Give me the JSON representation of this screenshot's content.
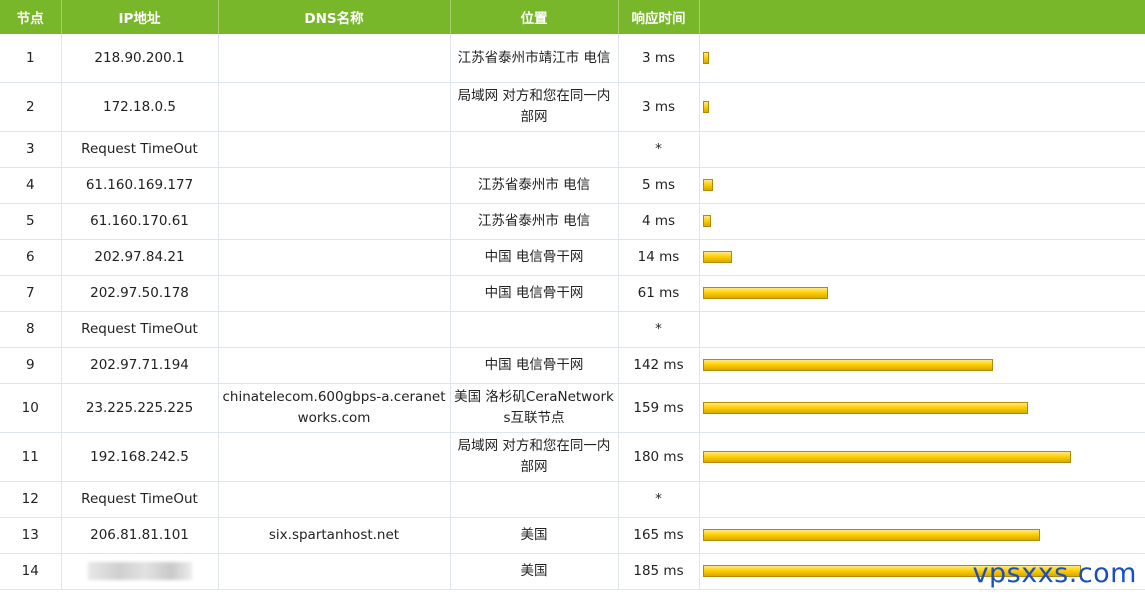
{
  "headers": {
    "hop": "节点",
    "ip": "IP地址",
    "dns": "DNS名称",
    "location": "位置",
    "time": "响应时间",
    "graph": ""
  },
  "bar_scale_ms": 185,
  "bar_color": "#ffd000",
  "header_color": "#78b62a",
  "rows": [
    {
      "hop": "1",
      "ip": "218.90.200.1",
      "dns": "",
      "location": "江苏省泰州市靖江市 电信",
      "time": "3 ms",
      "ms": 3,
      "tall": true
    },
    {
      "hop": "2",
      "ip": "172.18.0.5",
      "dns": "",
      "location": "局域网 对方和您在同一内部网",
      "time": "3 ms",
      "ms": 3,
      "tall": true
    },
    {
      "hop": "3",
      "ip": "Request TimeOut",
      "dns": "",
      "location": "",
      "time": "*",
      "ms": null,
      "tall": false
    },
    {
      "hop": "4",
      "ip": "61.160.169.177",
      "dns": "",
      "location": "江苏省泰州市 电信",
      "time": "5 ms",
      "ms": 5,
      "tall": false
    },
    {
      "hop": "5",
      "ip": "61.160.170.61",
      "dns": "",
      "location": "江苏省泰州市 电信",
      "time": "4 ms",
      "ms": 4,
      "tall": false
    },
    {
      "hop": "6",
      "ip": "202.97.84.21",
      "dns": "",
      "location": "中国 电信骨干网",
      "time": "14 ms",
      "ms": 14,
      "tall": false
    },
    {
      "hop": "7",
      "ip": "202.97.50.178",
      "dns": "",
      "location": "中国 电信骨干网",
      "time": "61 ms",
      "ms": 61,
      "tall": false
    },
    {
      "hop": "8",
      "ip": "Request TimeOut",
      "dns": "",
      "location": "",
      "time": "*",
      "ms": null,
      "tall": false
    },
    {
      "hop": "9",
      "ip": "202.97.71.194",
      "dns": "",
      "location": "中国 电信骨干网",
      "time": "142 ms",
      "ms": 142,
      "tall": false
    },
    {
      "hop": "10",
      "ip": "23.225.225.225",
      "dns": "chinatelecom.600gbps-a.ceranetworks.com",
      "location": "美国 洛杉矶CeraNetworks互联节点",
      "time": "159 ms",
      "ms": 159,
      "tall": true
    },
    {
      "hop": "11",
      "ip": "192.168.242.5",
      "dns": "",
      "location": "局域网 对方和您在同一内部网",
      "time": "180 ms",
      "ms": 180,
      "tall": true
    },
    {
      "hop": "12",
      "ip": "Request TimeOut",
      "dns": "",
      "location": "",
      "time": "*",
      "ms": null,
      "tall": false
    },
    {
      "hop": "13",
      "ip": "206.81.81.101",
      "dns": "six.spartanhost.net",
      "location": "美国",
      "time": "165 ms",
      "ms": 165,
      "tall": false
    },
    {
      "hop": "14",
      "ip": "",
      "ip_redacted": true,
      "dns": "",
      "location": "美国",
      "time": "185 ms",
      "ms": 185,
      "tall": false
    }
  ],
  "watermark": "vpsxxs.com"
}
